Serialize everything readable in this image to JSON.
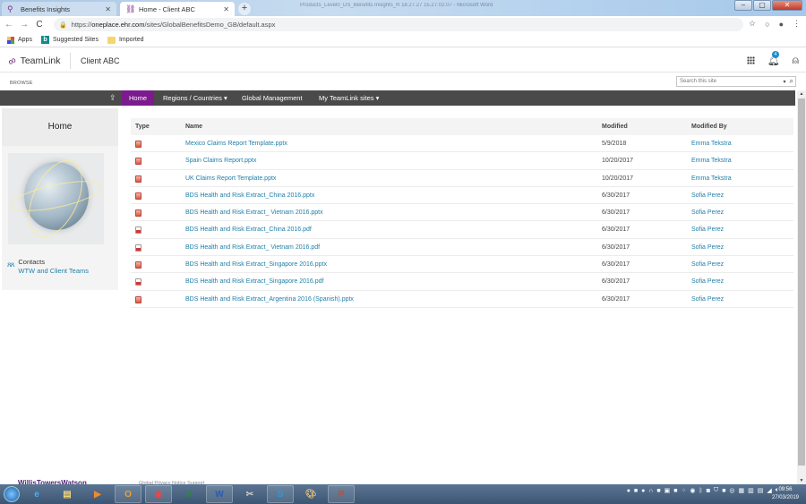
{
  "browser": {
    "tabs": [
      {
        "title": "Benefits Insights",
        "active": false
      },
      {
        "title": "Home - Client ABC",
        "active": true
      }
    ],
    "window_title": "Products_Level0_DS_Benefits Insights_R 18.27.27 15.27.02.07 - Microsoft Word",
    "url_prefix": "https://",
    "url_host": "oneplace.ehr.com",
    "url_path": "/sites/GlobalBenefitsDemo_GB/default.aspx",
    "bookmarks": [
      {
        "label": "Apps",
        "icon": "apps-grid-icon"
      },
      {
        "label": "Suggested Sites",
        "icon": "bing-icon"
      },
      {
        "label": "Imported",
        "icon": "folder-icon"
      }
    ]
  },
  "suitebar": {
    "brand": "TeamLink",
    "site_title": "Client ABC",
    "notification_count": "4"
  },
  "ribbon": {
    "browse_label": "BROWSE",
    "search_placeholder": "Search this site"
  },
  "topnav": {
    "items": [
      {
        "label": "Home",
        "selected": true
      },
      {
        "label": "Regions / Countries",
        "dropdown": true
      },
      {
        "label": "Global Management",
        "dropdown": false
      },
      {
        "label": "My TeamLink sites",
        "dropdown": true
      }
    ],
    "accent_color": "#7b1b8d"
  },
  "leftpanel": {
    "title": "Home",
    "contacts_label": "Contacts",
    "contacts_link": "WTW and Client Teams"
  },
  "documents": {
    "columns": [
      "Type",
      "Name",
      "Modified",
      "Modified By"
    ],
    "rows": [
      {
        "type": "pptx",
        "name": "Mexico Claims Report Template.pptx",
        "modified": "5/9/2018",
        "modified_by": "Emma Tekstra"
      },
      {
        "type": "pptx",
        "name": "Spain Claims Report.pptx",
        "modified": "10/20/2017",
        "modified_by": "Emma Tekstra"
      },
      {
        "type": "pptx",
        "name": "UK Claims Report Template.pptx",
        "modified": "10/20/2017",
        "modified_by": "Emma Tekstra"
      },
      {
        "type": "pptx",
        "name": "BDS Health and Risk Extract_China 2016.pptx",
        "modified": "6/30/2017",
        "modified_by": "Sofia Perez"
      },
      {
        "type": "pptx",
        "name": "BDS Health and Risk Extract_ Vietnam 2016.pptx",
        "modified": "6/30/2017",
        "modified_by": "Sofia Perez"
      },
      {
        "type": "pdf",
        "name": "BDS Health and Risk Extract_China 2016.pdf",
        "modified": "6/30/2017",
        "modified_by": "Sofia Perez"
      },
      {
        "type": "pdf",
        "name": "BDS Health and Risk Extract_ Vietnam 2016.pdf",
        "modified": "6/30/2017",
        "modified_by": "Sofia Perez"
      },
      {
        "type": "pptx",
        "name": "BDS Health and Risk Extract_Singapore 2016.pptx",
        "modified": "6/30/2017",
        "modified_by": "Sofia Perez"
      },
      {
        "type": "pdf",
        "name": "BDS Health and Risk Extract_Singapore 2016.pdf",
        "modified": "6/30/2017",
        "modified_by": "Sofia Perez"
      },
      {
        "type": "pptx",
        "name": "BDS Health and Risk Extract_Argentina 2016 (Spanish).pptx",
        "modified": "6/30/2017",
        "modified_by": "Sofia Perez"
      }
    ]
  },
  "footer": {
    "brand": "WillisTowersWatson",
    "links": "Global Privacy Notice   Support"
  },
  "taskbar": {
    "apps": [
      "internet-explorer",
      "file-explorer",
      "media-player",
      "outlook",
      "chrome",
      "excel",
      "word",
      "snipping-tool",
      "skype",
      "paint",
      "powerpoint"
    ],
    "time": "09:56",
    "date": "27/03/2019"
  }
}
